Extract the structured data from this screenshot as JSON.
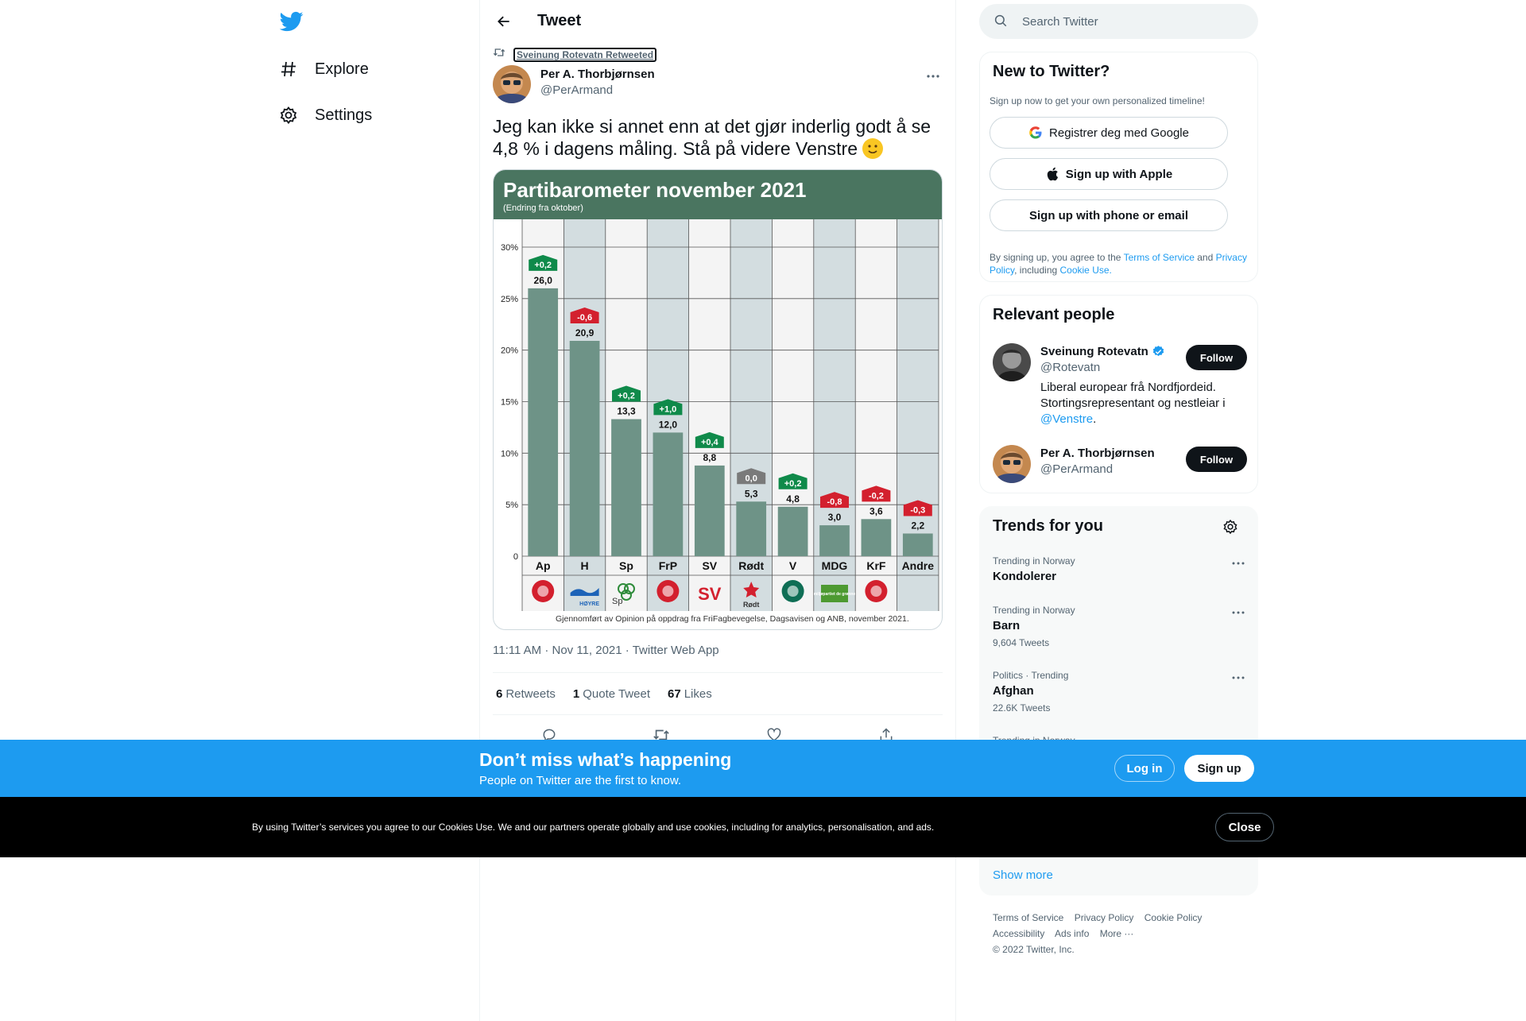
{
  "nav": {
    "items": [
      {
        "label": "Explore",
        "icon": "hashtag-icon"
      },
      {
        "label": "Settings",
        "icon": "gear-icon"
      }
    ]
  },
  "header": {
    "title": "Tweet"
  },
  "tweet": {
    "retweeted_by": "Sveinung Rotevatn Retweeted",
    "author_name": "Per A. Thorbjørnsen",
    "author_handle": "@PerArmand",
    "text": "Jeg kan ikke si annet enn at det gjør inderlig godt å se 4,8 % i dagens måling.  Stå på videre Venstre",
    "emoji": "slightly-smiling-face",
    "time": "11:11 AM",
    "date": "Nov 11, 2021",
    "source": "Twitter Web App",
    "retweets": "6",
    "retweets_label": "Retweets",
    "quotes": "1",
    "quotes_label": "Quote Tweet",
    "likes": "67",
    "likes_label": "Likes"
  },
  "chart_data": {
    "type": "bar",
    "title": "Partibarometer november 2021",
    "subtitle": "(Endring fra oktober)",
    "categories": [
      "Ap",
      "H",
      "Sp",
      "FrP",
      "SV",
      "Rødt",
      "V",
      "MDG",
      "KrF",
      "Andre"
    ],
    "values": [
      26.0,
      20.9,
      13.3,
      12.0,
      8.8,
      5.3,
      4.8,
      3.0,
      3.6,
      2.2
    ],
    "value_labels": [
      "26,0",
      "20,9",
      "13,3",
      "12,0",
      "8,8",
      "5,3",
      "4,8",
      "3,0",
      "3,6",
      "2,2"
    ],
    "changes": [
      "+0,2",
      "-0,6",
      "+0,2",
      "+1,0",
      "+0,4",
      "0,0",
      "+0,2",
      "-0,8",
      "-0,2",
      "-0,3"
    ],
    "yticks": [
      "0",
      "5%",
      "10%",
      "15%",
      "20%",
      "25%",
      "30%"
    ],
    "ylim": [
      0,
      30
    ],
    "source_note": "Gjennomført av Opinion på oppdrag fra FriFagbevegelse, Dagsavisen og ANB, november 2021.",
    "logo_text": {
      "H": "HØYRE",
      "Sp": "Sp",
      "Rødt": "Rødt",
      "MDG": "miljøpartiet de grønne"
    },
    "colors": {
      "header": "#4a7560",
      "bar": "#6e9387",
      "up": "#0f8a4a",
      "down": "#d3202e",
      "zero": "#7a7a7a",
      "shade": "#d3dde0"
    }
  },
  "search": {
    "placeholder": "Search Twitter"
  },
  "signup_card": {
    "title": "New to Twitter?",
    "subtitle": "Sign up now to get your own personalized timeline!",
    "google": "Registrer deg med Google",
    "apple": "Sign up with Apple",
    "phone": "Sign up with phone or email",
    "legal_1": "By signing up, you agree to the ",
    "terms": "Terms of Service",
    "legal_2": " and ",
    "privacy": "Privacy Policy",
    "legal_3": ", including ",
    "cookie": "Cookie Use."
  },
  "people": {
    "title": "Relevant people",
    "items": [
      {
        "name": "Sveinung Rotevatn",
        "handle": "@Rotevatn",
        "bio": "Liberal europear frå Nordfjordeid. Stortingsrepresentant og nestleiar i ",
        "bio_link": "@Venstre",
        "bio_end": ".",
        "follow": "Follow"
      },
      {
        "name": "Per A. Thorbjørnsen",
        "handle": "@PerArmand",
        "follow": "Follow"
      }
    ]
  },
  "trends": {
    "title": "Trends for you",
    "items": [
      {
        "meta": "Trending in Norway",
        "name": "Kondolerer",
        "count": ""
      },
      {
        "meta": "Trending in Norway",
        "name": "Barn",
        "count": "9,604 Tweets"
      },
      {
        "meta": "Politics · Trending",
        "name": "Afghan",
        "count": "22.6K Tweets"
      },
      {
        "meta": "Trending in Norway",
        "name": "",
        "count": ""
      }
    ],
    "show_more": "Show more"
  },
  "footer": {
    "links": [
      "Terms of Service",
      "Privacy Policy",
      "Cookie Policy",
      "Accessibility",
      "Ads info",
      "More ···"
    ],
    "copyright": "© 2022 Twitter, Inc."
  },
  "promo": {
    "title": "Don’t miss what’s happening",
    "subtitle": "People on Twitter are the first to know.",
    "login": "Log in",
    "signup": "Sign up"
  },
  "cookie": {
    "text": "By using Twitter’s services you agree to our Cookies Use. We and our partners operate globally and use cookies, including for analytics, personalisation, and ads.",
    "close": "Close"
  }
}
